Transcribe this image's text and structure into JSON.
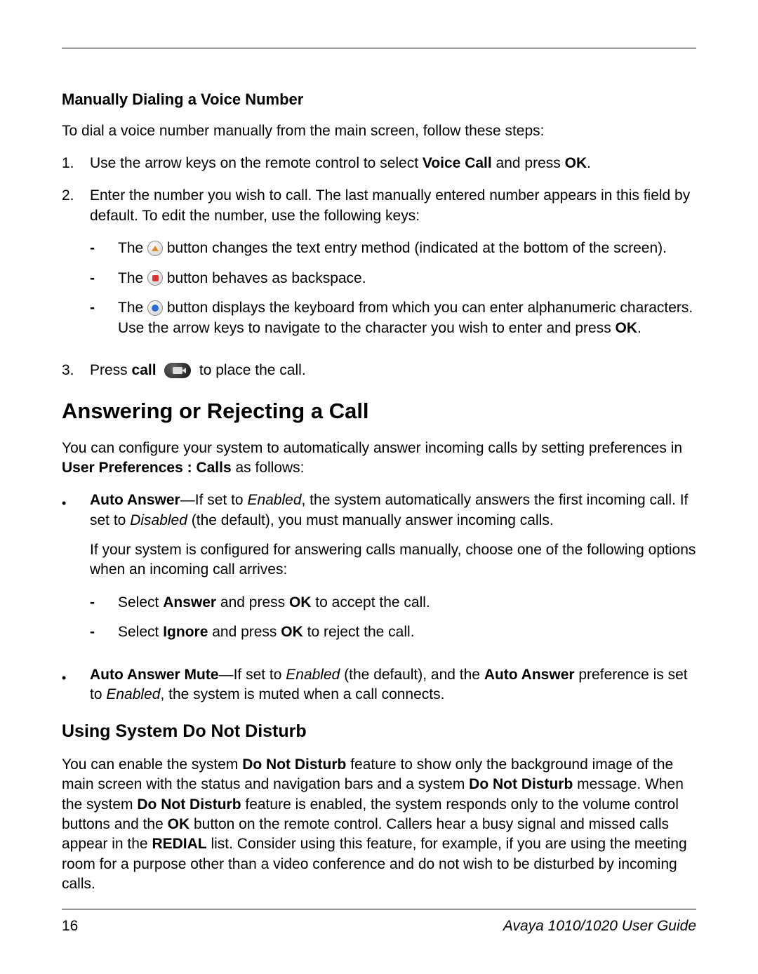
{
  "section1": {
    "heading": "Manually Dialing a Voice Number",
    "intro": "To dial a voice number manually from the main screen, follow these steps:",
    "step1_num": "1.",
    "step1_a": "Use the arrow keys on the remote control to select ",
    "step1_b": "Voice Call",
    "step1_c": " and press ",
    "step1_d": "OK",
    "step1_e": ".",
    "step2_num": "2.",
    "step2": "Enter the number you wish to call. The last manually entered number appears in this field by default. To edit the number, use the following keys:",
    "step2_d1_a": "The ",
    "step2_d1_b": " button changes the text entry method (indicated at the bottom of the screen).",
    "step2_d2_a": "The ",
    "step2_d2_b": " button behaves as backspace.",
    "step2_d3_a": "The ",
    "step2_d3_b": " button displays the keyboard from which you can enter alphanumeric characters. Use the arrow keys to navigate to the character you wish to enter and press ",
    "step2_d3_c": "OK",
    "step2_d3_d": ".",
    "step3_num": "3.",
    "step3_a": "Press ",
    "step3_b": "call",
    "step3_c": " to place the call."
  },
  "section2": {
    "heading": "Answering or Rejecting a Call",
    "intro_a": "You can configure your system to automatically answer incoming calls by setting preferences in ",
    "intro_b": "User Preferences : Calls",
    "intro_c": " as follows:",
    "b1_a": "Auto Answer",
    "b1_b": "—If set to ",
    "b1_c": "Enabled",
    "b1_d": ", the system automatically answers the first incoming call. If set to ",
    "b1_e": "Disabled",
    "b1_f": " (the default), you must manually answer incoming calls.",
    "b1_p": "If your system is configured for answering calls manually, choose one of the following options when an incoming call arrives:",
    "b1_d1_a": "Select ",
    "b1_d1_b": "Answer",
    "b1_d1_c": " and press ",
    "b1_d1_d": "OK",
    "b1_d1_e": " to accept the call.",
    "b1_d2_a": "Select ",
    "b1_d2_b": "Ignore",
    "b1_d2_c": " and press ",
    "b1_d2_d": "OK",
    "b1_d2_e": " to reject the call.",
    "b2_a": "Auto Answer Mute",
    "b2_b": "—If set to ",
    "b2_c": "Enabled",
    "b2_d": " (the default), and the ",
    "b2_e": "Auto Answer",
    "b2_f": " preference is set to ",
    "b2_g": "Enabled",
    "b2_h": ", the system is muted when a call connects."
  },
  "section3": {
    "heading": "Using System Do Not Disturb",
    "p_a": "You can enable the system ",
    "p_b": "Do Not Disturb",
    "p_c": " feature to show only the background image of the main screen with the status and navigation bars and a system ",
    "p_d": "Do Not Disturb",
    "p_e": " message. When the system ",
    "p_f": "Do Not Disturb",
    "p_g": " feature is enabled, the system responds only to the volume control buttons and the ",
    "p_h": "OK",
    "p_i": " button on the remote control. Callers hear a busy signal and missed calls appear in the ",
    "p_j": "REDIAL",
    "p_k": " list. Consider using this feature, for example, if you are using the meeting room for a purpose other than a video conference and do not wish to be disturbed by incoming calls."
  },
  "footer": {
    "page_number": "16",
    "doc_title": "Avaya 1010/1020 User Guide"
  },
  "dash": "-"
}
